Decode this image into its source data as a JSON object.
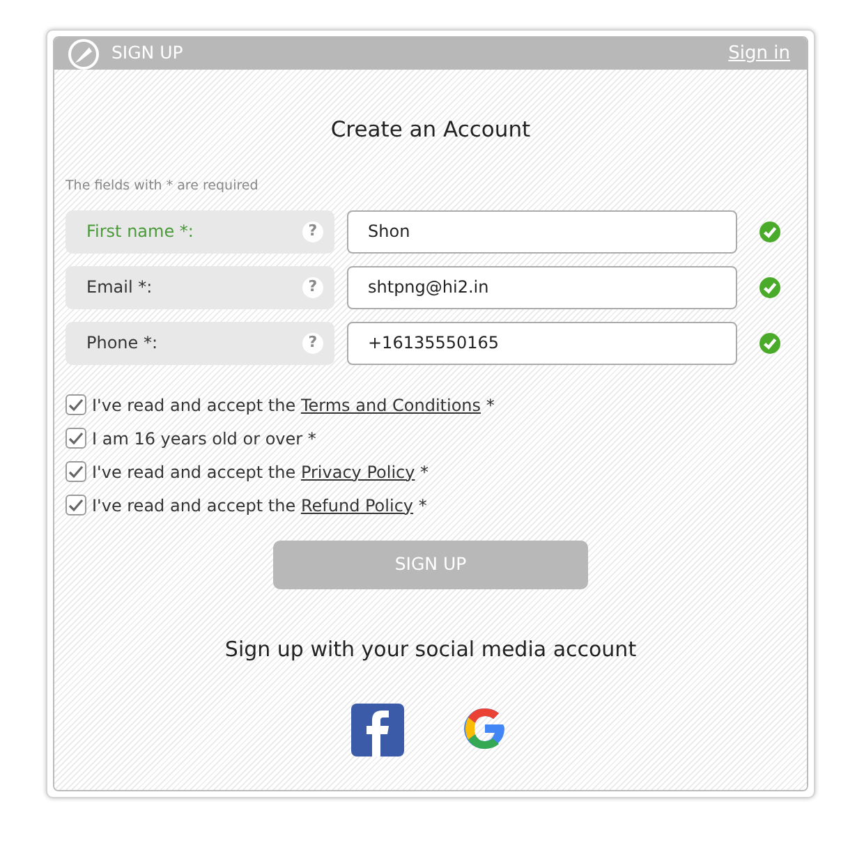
{
  "header": {
    "title": "SIGN UP",
    "link": "Sign in"
  },
  "form": {
    "title": "Create an Account",
    "required_note": "The fields with * are required",
    "fields": [
      {
        "label": "First name *:",
        "help": "?",
        "value": "Shon",
        "focused": true,
        "valid": true
      },
      {
        "label": "Email *:",
        "help": "?",
        "value": "shtpng@hi2.in",
        "focused": false,
        "valid": true
      },
      {
        "label": "Phone *:",
        "help": "?",
        "value": "+16135550165",
        "focused": false,
        "valid": true
      }
    ],
    "agreements": [
      {
        "before": "I've read and accept the ",
        "link": "Terms and Conditions",
        "after": " *",
        "checked": true
      },
      {
        "before": "I am 16 years old or over *",
        "checked": true
      },
      {
        "before": "I've read and accept the ",
        "link": "Privacy Policy",
        "after": " *",
        "checked": true
      },
      {
        "before": "I've read and accept the ",
        "link": "Refund Policy",
        "after": " *",
        "checked": true
      }
    ],
    "submit": {
      "label": "SIGN UP",
      "disabled": true
    }
  },
  "social": {
    "title": "Sign up with your social media account",
    "providers": [
      {
        "kind": "facebook"
      },
      {
        "kind": "google"
      }
    ]
  }
}
